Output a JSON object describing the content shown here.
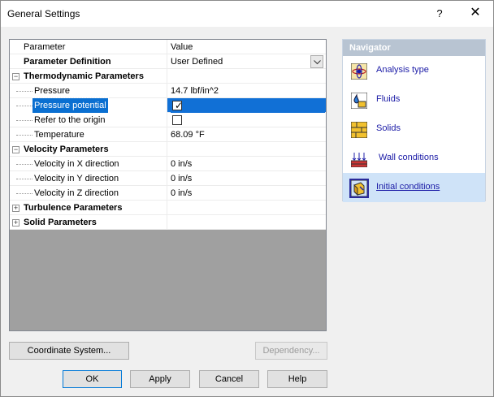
{
  "window": {
    "title": "General Settings",
    "help_label": "?",
    "close_label": "✕"
  },
  "grid": {
    "col_parameter": "Parameter",
    "col_value": "Value",
    "definition_label": "Parameter Definition",
    "definition_value": "User Defined",
    "thermo_group": "Thermodynamic Parameters",
    "pressure_label": "Pressure",
    "pressure_value": "14.7 lbf/in^2",
    "pressure_potential_label": "Pressure potential",
    "refer_origin_label": "Refer to the origin",
    "temperature_label": "Temperature",
    "temperature_value": "68.09 °F",
    "velocity_group": "Velocity Parameters",
    "vx_label": "Velocity in X direction",
    "vx_value": "0 in/s",
    "vy_label": "Velocity in Y direction",
    "vy_value": "0 in/s",
    "vz_label": "Velocity in Z direction",
    "vz_value": "0 in/s",
    "turbulence_group": "Turbulence Parameters",
    "solid_group": "Solid Parameters",
    "pressure_potential_checked": true,
    "refer_origin_checked": false
  },
  "navigator": {
    "title": "Navigator",
    "items": [
      {
        "label": "Analysis type",
        "icon": "analysis-type-icon"
      },
      {
        "label": "Fluids",
        "icon": "fluids-icon"
      },
      {
        "label": "Solids",
        "icon": "solids-icon"
      },
      {
        "label": "Wall conditions",
        "icon": "wall-conditions-icon"
      },
      {
        "label": "Initial conditions",
        "icon": "initial-conditions-icon"
      }
    ]
  },
  "buttons": {
    "coordinate_system": "Coordinate System...",
    "dependency": "Dependency...",
    "ok": "OK",
    "apply": "Apply",
    "cancel": "Cancel",
    "help": "Help"
  },
  "colors": {
    "selection": "#1170d6",
    "nav_header": "#b8c4d2",
    "nav_link": "#1a1aa6"
  }
}
